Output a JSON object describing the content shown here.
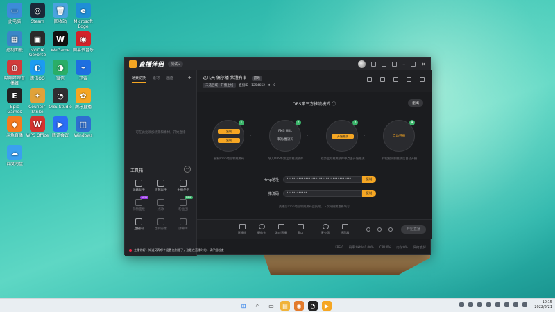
{
  "desktop": {
    "icons": [
      {
        "label": "此电脑",
        "color": "#3d8bd9",
        "glyph": "▭"
      },
      {
        "label": "Steam",
        "color": "#1b2838",
        "glyph": "◎"
      },
      {
        "label": "回收站",
        "color": "#4aa3df",
        "glyph": "🗑"
      },
      {
        "label": "Microsoft Edge",
        "color": "#1f8ed6",
        "glyph": "e"
      },
      {
        "label": "控制面板",
        "color": "#3a86c8",
        "glyph": "▦"
      },
      {
        "label": "NVIDIA GeForce",
        "color": "#2a2a2a",
        "glyph": "▣"
      },
      {
        "label": "WeGame",
        "color": "#111",
        "glyph": "W"
      },
      {
        "label": "网易云音乐",
        "color": "#d2232a",
        "glyph": "◉"
      },
      {
        "label": "哔哩哔哩直播姬",
        "color": "#d23b3b",
        "glyph": "◍"
      },
      {
        "label": "腾讯QQ",
        "color": "#1b9cf2",
        "glyph": "◐"
      },
      {
        "label": "微信",
        "color": "#2aae67",
        "glyph": "◑"
      },
      {
        "label": "迅雷",
        "color": "#1e6fe0",
        "glyph": "⌁"
      },
      {
        "label": "Epic Games Launcher",
        "color": "#222",
        "glyph": "E"
      },
      {
        "label": "Counter-Strike",
        "color": "#e0a23a",
        "glyph": "✦"
      },
      {
        "label": "OBS Studio",
        "color": "#302e31",
        "glyph": "◔"
      },
      {
        "label": "虎牙直播",
        "color": "#f5a623",
        "glyph": "✿"
      },
      {
        "label": "斗鱼直播",
        "color": "#f57a1f",
        "glyph": "◆"
      },
      {
        "label": "WPS Office",
        "color": "#d3332f",
        "glyph": "W"
      },
      {
        "label": "腾讯会议",
        "color": "#2b6ef5",
        "glyph": "▶"
      },
      {
        "label": "Windows",
        "color": "#2e6fd0",
        "glyph": "◫"
      },
      {
        "label": "百度网盘",
        "color": "#3aa0ef",
        "glyph": "☁"
      }
    ]
  },
  "app": {
    "name": "直播伴侣",
    "version_badge": "测试 ▸",
    "sidebar": {
      "tabs": [
        "场景切换",
        "素材",
        "画面"
      ],
      "empty_text": "可在此处添加场景和素材，开始直播",
      "tools_title": "工具箱",
      "tools": [
        {
          "label": "弹幕助手",
          "dim": false,
          "tag": ""
        },
        {
          "label": "房管助手",
          "dim": false,
          "tag": ""
        },
        {
          "label": "主播任务",
          "dim": false,
          "tag": ""
        },
        {
          "label": "礼物面板",
          "dim": true,
          "tag": "NEW"
        },
        {
          "label": "点歌",
          "dim": true,
          "tag": ""
        },
        {
          "label": "粉丝团",
          "dim": true,
          "tag": "NEW"
        },
        {
          "label": "直播间",
          "dim": false,
          "tag": ""
        },
        {
          "label": "虚拟形象",
          "dim": true,
          "tag": ""
        },
        {
          "label": "弹幕库",
          "dim": true,
          "tag": ""
        }
      ],
      "notice": "主播你好，知道又弄哪个设置也别提了，这是在直播时的，请仔细检查"
    },
    "room": {
      "title": "这几天 偶尔播 紫澄有事",
      "category": "游戏",
      "pill": "未选区域 · 开播上线",
      "id_label": "直播ID",
      "id_value": "1254652",
      "likes": "0"
    },
    "obs": {
      "title": "OBS第三方推流模式",
      "exit": "退出",
      "steps": [
        {
          "num": "1",
          "top": "复制",
          "bottom": "复制",
          "caption": "复制rtmp地址和推流码"
        },
        {
          "num": "2",
          "top": "FMS URL",
          "bottom": "串流/推流码",
          "caption": "填入OBS等第三方推流软件"
        },
        {
          "num": "3",
          "top": "开始推流",
          "bottom": "",
          "caption": "在第三方推流软件中点击开始推流"
        },
        {
          "num": "4",
          "top": "自动开播",
          "bottom": "",
          "caption": "伴侣检测到推流后自动开播"
        }
      ],
      "fields": [
        {
          "label": "rtmp地址",
          "value": "••••••••••••••••••••••••••••••••••••••",
          "copy": "复制"
        },
        {
          "label": "推流码",
          "value": "••••••••••••",
          "copy": "复制"
        }
      ],
      "hint": "关播后rtmp地址和推流码会失效，下次开播需重新填写"
    },
    "toolbar": [
      "直播间",
      "摄像头",
      "游戏直播",
      "窗口",
      "麦克风",
      "扬声器"
    ],
    "go_live": "开始直播",
    "status": [
      "FPS:0",
      "码率:0kb/s 0.00%",
      "CPU:0%",
      "内存:0%",
      "网络:良好"
    ]
  },
  "taskbar": {
    "time": "10:15",
    "date": "2022/5/21"
  }
}
